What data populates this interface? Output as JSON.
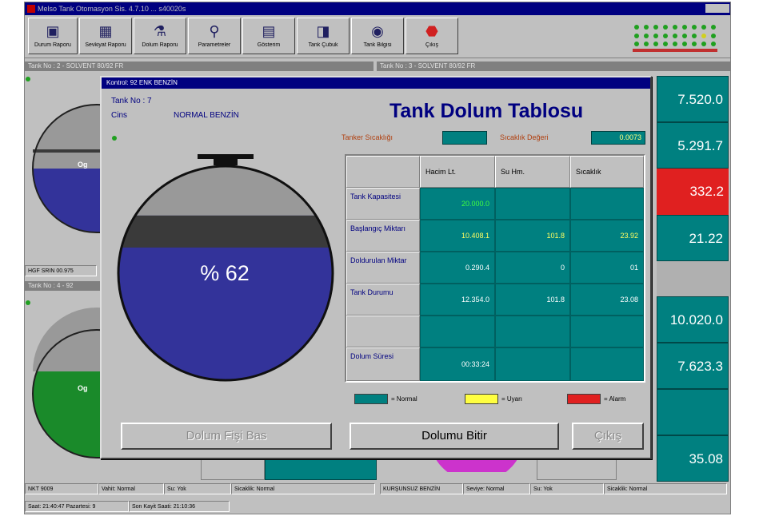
{
  "window": {
    "title": "Melso  Tank Otomasyon Sis. 4.7.10 ... s40020s"
  },
  "toolbar": {
    "buttons": [
      {
        "label": "Durum Raporu",
        "icon": "tank-report-icon",
        "glyph": "▣"
      },
      {
        "label": "Sevkiyat Raporu",
        "icon": "calendar-icon",
        "glyph": "▦"
      },
      {
        "label": "Dolum Raporu",
        "icon": "bottle-icon",
        "glyph": "⚗"
      },
      {
        "label": "Parametreler",
        "icon": "magnifier-icon",
        "glyph": "⚲"
      },
      {
        "label": "Gösterim",
        "icon": "layout-icon",
        "glyph": "▤"
      },
      {
        "label": "Tank Çubuk",
        "icon": "floppy-disk-icon",
        "glyph": "◨"
      },
      {
        "label": "Tank Bilgisi",
        "icon": "eye-icon",
        "glyph": "◉"
      },
      {
        "label": "Çıkış",
        "icon": "stop-icon",
        "glyph": "⬣"
      }
    ]
  },
  "background": {
    "panel_left_title": "Tank No : 2 - SOLVENT 80/92 FR",
    "panel_right_title": "Tank No : 3 - SOLVENT 80/92 FR",
    "panel_left2_title": "Tank No : 4 - 92",
    "gauge_label_1": "Og",
    "gauge_label_2": "Og",
    "status_left": "HGF SRIN 00.975",
    "teal_values": [
      "7.520.0",
      "5.291.7",
      "332.2",
      "21.22",
      "10.020.0",
      "7.623.3",
      "35.08"
    ],
    "bottom_status": [
      "NKT 9009",
      "Vahit: Normal",
      "Su: Yok",
      "Sicaklik: Normal",
      "KURŞUNSUZ BENZİN",
      "Seviye: Normal",
      "Su: Yok",
      "Sicaklik: Normal"
    ],
    "footer_status": [
      "Saat: 21:40:47  Pazartesi: 9",
      "Son Kayit Saati: 21:10:36"
    ]
  },
  "dialog": {
    "title": "Kontrol: 92 ENK BENZİN",
    "tank_no_label": "Tank No : 7",
    "cins_label": "Cins",
    "cins_value": "NORMAL BENZİN",
    "heading": "Tank Dolum Tablosu",
    "sensor_label": "Tanker Sıcaklığı",
    "sensor_value": "",
    "density_label": "Sıcaklık Değeri",
    "density_value": "0.0073",
    "gauge_percent_text": "% 62",
    "gauge_fill_fraction": 0.62,
    "columns": [
      "Hacim Lt.",
      "Su Hm.",
      "Sıcaklık"
    ],
    "rows": [
      {
        "label": "Tank Kapasitesi",
        "values": [
          "20.000.0",
          "",
          ""
        ]
      },
      {
        "label": "Başlangıç Miktarı",
        "values": [
          "10.408.1",
          "101.8",
          "23.92"
        ]
      },
      {
        "label": "Doldurulan Miktar",
        "values": [
          "0.290.4",
          "0",
          "01"
        ]
      },
      {
        "label": "Tank Durumu",
        "values": [
          "12.354.0",
          "101.8",
          "23.08"
        ]
      },
      {
        "label": "",
        "values": [
          "",
          "",
          ""
        ]
      },
      {
        "label": "Dolum Süresi",
        "values": [
          "00:33:24",
          "",
          ""
        ]
      }
    ],
    "legend": [
      {
        "label": "= Normal",
        "color": "#008080"
      },
      {
        "label": "= Uyarı",
        "color": "#ffff40"
      },
      {
        "label": "= Alarm",
        "color": "#e02020"
      }
    ],
    "buttons": {
      "print": "Dolum Fişi Bas",
      "finish": "Dolumu Bitir",
      "exit": "Çıkış"
    },
    "colors": {
      "gas": "#999999",
      "liquid": "#33339a",
      "band": "#3a3a3a",
      "teal": "#008080",
      "green_text": "#40ff40",
      "yellow_text": "#ffff60",
      "white_text": "#ffffff"
    }
  }
}
